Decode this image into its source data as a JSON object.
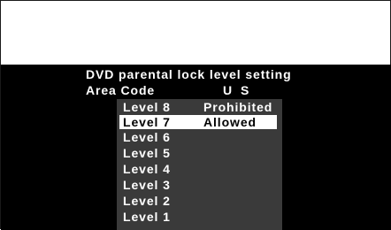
{
  "title": "DVD parental lock level setting",
  "area": {
    "label": "Area Code",
    "value": "U S"
  },
  "levels": [
    {
      "label": "Level 8",
      "status": "Prohibited",
      "selected": false
    },
    {
      "label": "Level 7",
      "status": "Allowed",
      "selected": true
    },
    {
      "label": "Level 6",
      "status": "",
      "selected": false
    },
    {
      "label": "Level 5",
      "status": "",
      "selected": false
    },
    {
      "label": "Level 4",
      "status": "",
      "selected": false
    },
    {
      "label": "Level 3",
      "status": "",
      "selected": false
    },
    {
      "label": "Level 2",
      "status": "",
      "selected": false
    },
    {
      "label": "Level 1",
      "status": "",
      "selected": false
    }
  ],
  "colors": {
    "background": "#000000",
    "menu_background": "#3a3a3a",
    "highlight": "#ffffff",
    "text": "#ffffff"
  }
}
